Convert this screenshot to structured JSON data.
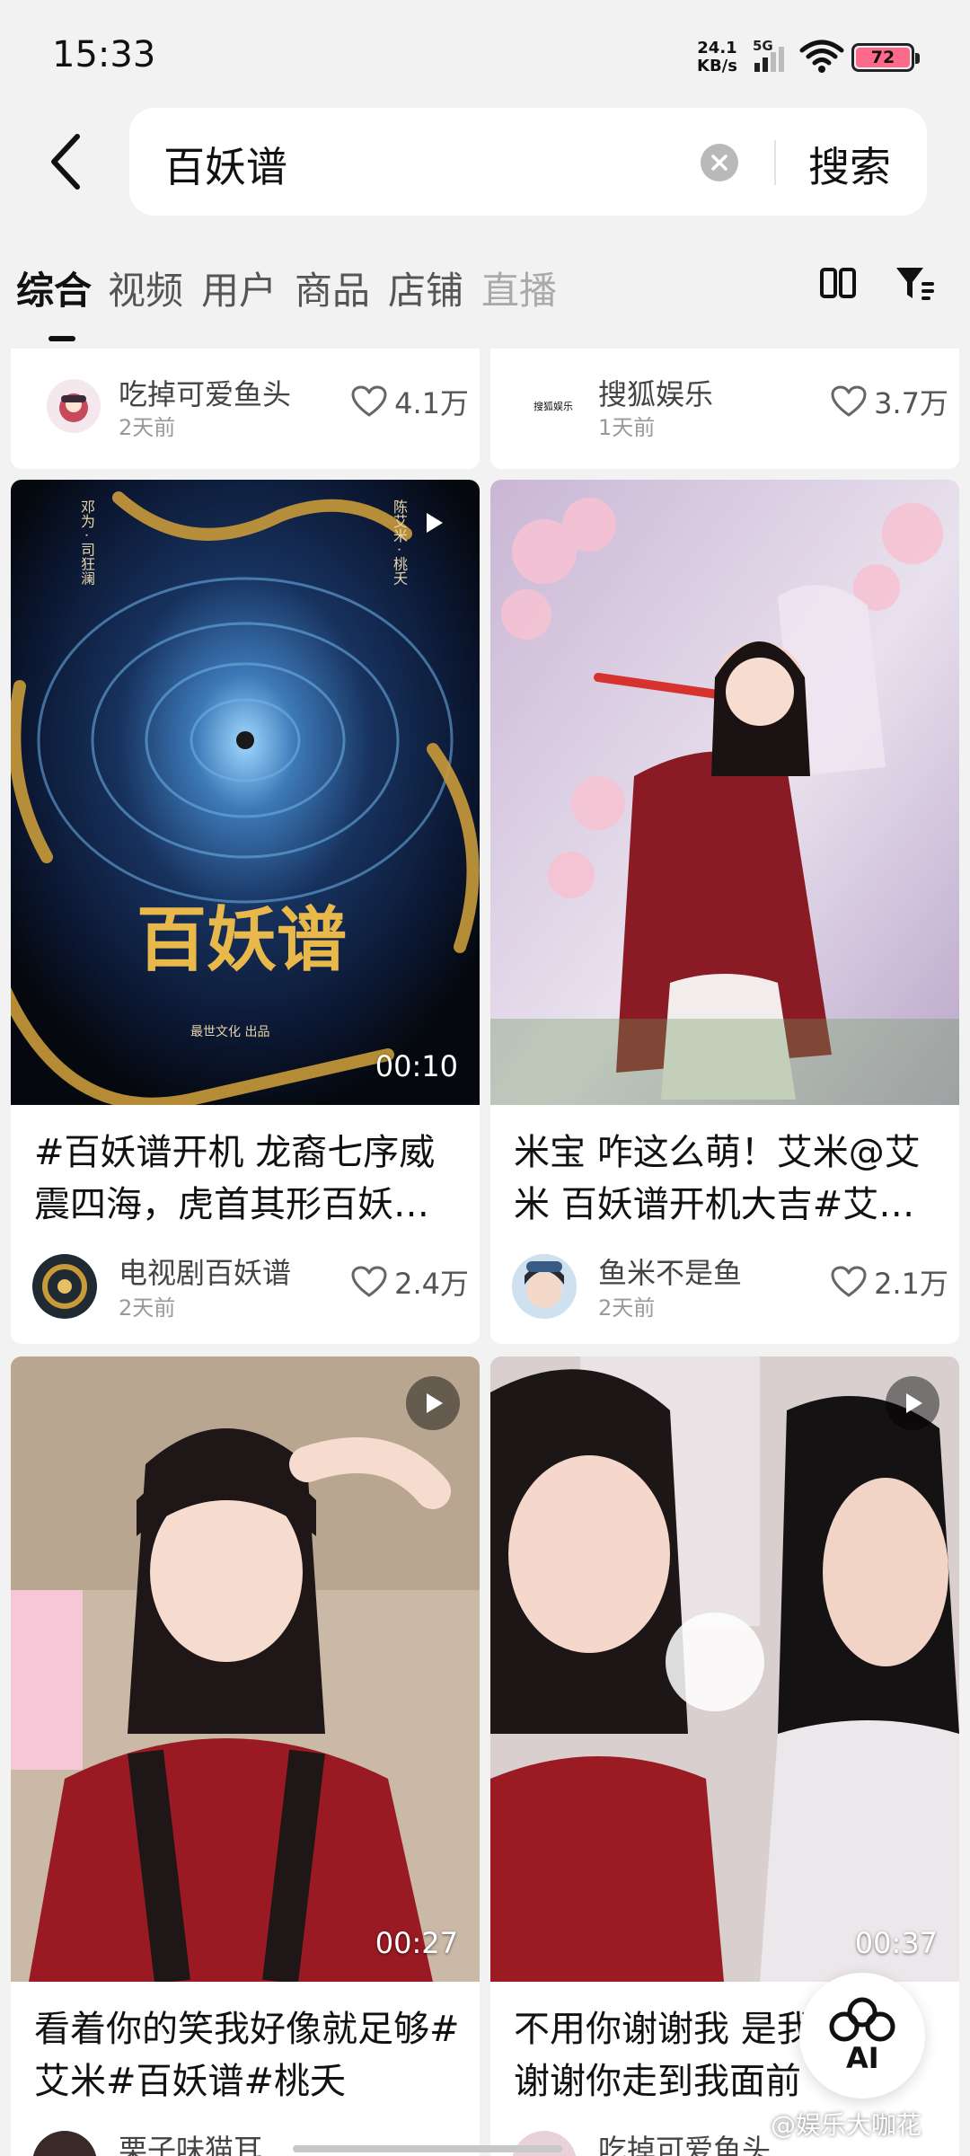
{
  "status_bar": {
    "time": "15:33",
    "net_speed_value": "24.1",
    "net_speed_unit": "KB/s",
    "network": "5G",
    "battery": "72",
    "battery_color": "#ff6a8a"
  },
  "search": {
    "query": "百妖谱",
    "submit_label": "搜索"
  },
  "tabs": [
    {
      "label": "综合",
      "active": true
    },
    {
      "label": "视频",
      "active": false
    },
    {
      "label": "用户",
      "active": false
    },
    {
      "label": "商品",
      "active": false
    },
    {
      "label": "店铺",
      "active": false
    },
    {
      "label": "直播",
      "active": false
    }
  ],
  "icons": {
    "back": "back-arrow-icon",
    "clear": "clear-icon",
    "grid_view": "grid-view-icon",
    "filter": "filter-icon",
    "like": "heart-icon",
    "play": "play-icon",
    "ai": "ai-icon"
  },
  "feed": {
    "top_row": [
      {
        "author": "吃掉可爱鱼头",
        "time": "2天前",
        "likes": "4.1万"
      },
      {
        "author": "搜狐娱乐",
        "time": "1天前",
        "likes": "3.7万",
        "avatar_text": "搜狐娱乐"
      }
    ],
    "cards": [
      {
        "title": "#百妖谱开机 龙裔七序威震四海，虎首其形百妖…",
        "author": "电视剧百妖谱",
        "time": "2天前",
        "likes": "2.4万",
        "duration": "00:10",
        "poster_title": "百妖谱",
        "poster_credit": "最世文化 出品",
        "poster_names_left": "邓为 · 司狂澜",
        "poster_names_right": "陈艾米 · 桃夭"
      },
      {
        "title": "米宝 咋这么萌！艾米@艾米 百妖谱开机大吉#艾…",
        "author": "鱼米不是鱼",
        "time": "2天前",
        "likes": "2.1万"
      },
      {
        "title": "看着你的笑我好像就足够#艾米#百妖谱#桃夭",
        "author": "栗子味猫耳",
        "duration": "00:27"
      },
      {
        "title": "不用你谢谢我 是我想谢谢你走到我面前",
        "author": "吃掉可爱鱼头",
        "duration": "00:37"
      }
    ]
  },
  "ai_button": {
    "label": "AI"
  },
  "watermark": "@娱乐大咖花"
}
